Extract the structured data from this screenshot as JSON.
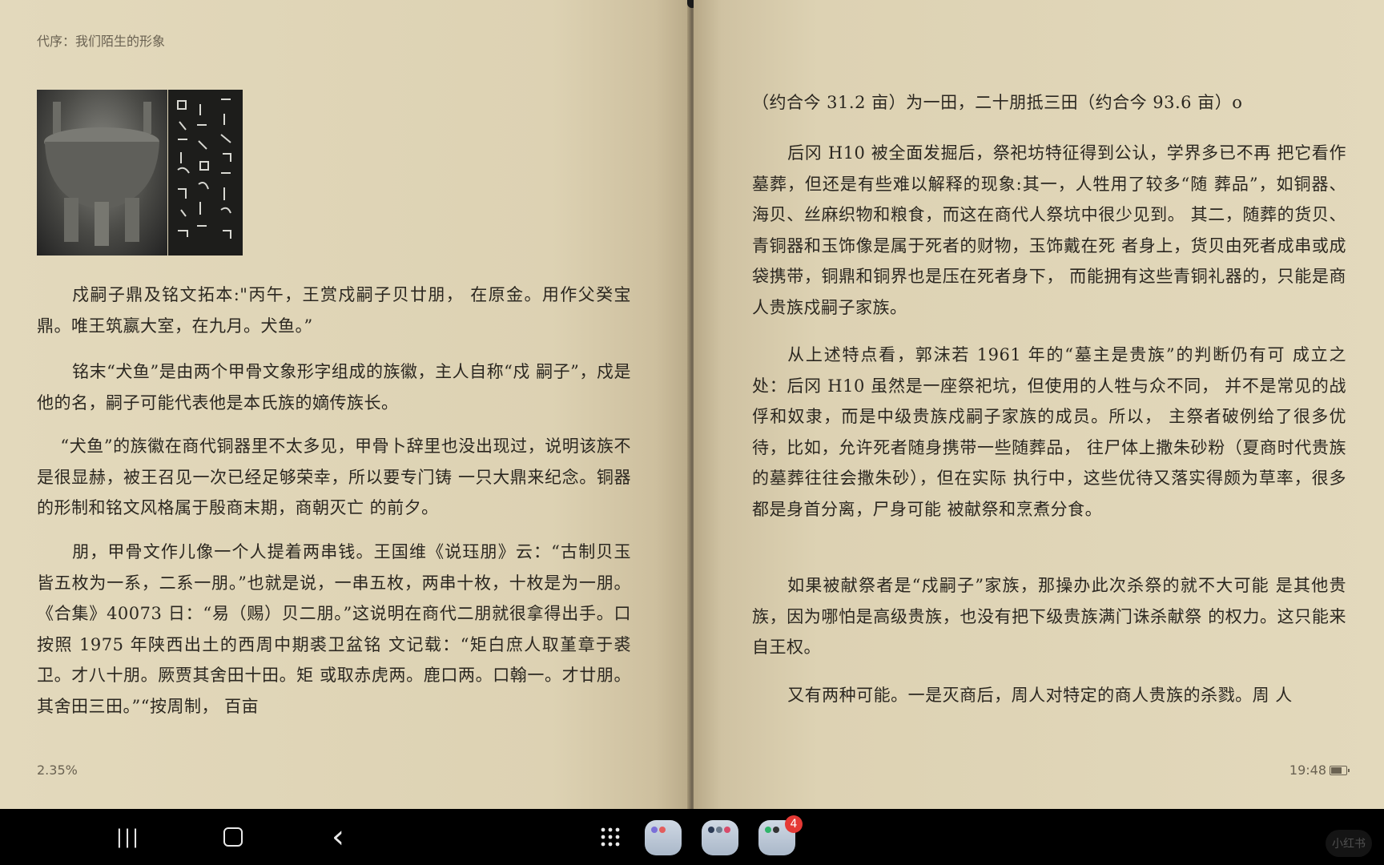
{
  "left_page": {
    "chapter_title": "代序：我们陌生的形象",
    "paragraphs": [
      "戍嗣子鼎及铭文拓本:\"丙午，王赏戍嗣子贝廿朋， 在原金。用作父癸宝鼎。唯王筑嬴大室，在九月。犬鱼。”",
      "铭末“犬鱼”是由两个甲骨文象形字组成的族徽，主人自称“戍 嗣子”，戍是他的名，嗣子可能代表他是本氏族的嫡传族长。",
      "“犬鱼”的族徽在商代铜器里不太多见，甲骨卜辞里也没出现过，说明该族不是很显赫，被王召见一次已经足够荣幸，所以要专门铸 一只大鼎来纪念。铜器的形制和铭文风格属于殷商末期，商朝灭亡 的前夕。",
      "朋，甲骨文作儿像一个人提着两串钱。王国维《说珏朋》云：“古制贝玉皆五枚为一系，二系一朋。”也就是说，一串五枚，两串十枚，十枚是为一朋。《合集》40073 日：“易（赐）贝二朋。”这说明在商代二朋就很拿得出手。口按照 1975 年陕西出土的西周中期裘卫盆铭 文记载：“矩白庶人取堇章于裘卫。才八十朋。厥贾其舍田十田。矩 或取赤虎两。鹿口两。口翰一。才廿朋。其舍田三田。”“按周制， 百亩"
    ],
    "progress": "2.35%"
  },
  "right_page": {
    "paragraphs": [
      "（约合今 31.2 亩）为一田，二十朋抵三田（约合今 93.6 亩）o",
      "后冈 H10 被全面发掘后，祭祀坊特征得到公认，学界多已不再 把它看作墓葬，但还是有些难以解释的现象:其一，人牲用了较多“随 葬品”，如铜器、海贝、丝麻织物和粮食，而这在商代人祭坑中很少见到。 其二，随葬的货贝、青铜器和玉饰像是属于死者的财物，玉饰戴在死 者身上，货贝由死者成串或成袋携带，铜鼎和铜界也是压在死者身下， 而能拥有这些青铜礼器的，只能是商人贵族戍嗣子家族。",
      "从上述特点看，郭沫若 1961 年的“墓主是贵族”的判断仍有可 成立之处：后冈 H10 虽然是一座祭祀坑，但使用的人牲与众不同， 并不是常见的战俘和奴隶，而是中级贵族戍嗣子家族的成员。所以， 主祭者破例给了很多优待，比如，允许死者随身携带一些随葬品， 往尸体上撒朱砂粉（夏商时代贵族的墓葬往往会撒朱砂），但在实际 执行中，这些优待又落实得颇为草率，很多都是身首分离，尸身可能 被献祭和烹煮分食。",
      "如果被献祭者是“戍嗣子”家族，那操办此次杀祭的就不大可能 是其他贵族，因为哪怕是高级贵族，也没有把下级贵族满门诛杀献祭 的权力。这只能来自王权。",
      "又有两种可能。一是灭商后，周人对特定的商人贵族的杀戮。周 人"
    ],
    "time": "19:48"
  },
  "navbar": {
    "recents_glyph": "|||",
    "home_glyph": "○",
    "back_glyph": "‹",
    "badge_count": "4",
    "watermark": "小红书"
  },
  "colors": {
    "paper": "#e0d5b8",
    "text": "#2b2720",
    "status_text": "#6a6252",
    "badge": "#e53935"
  }
}
